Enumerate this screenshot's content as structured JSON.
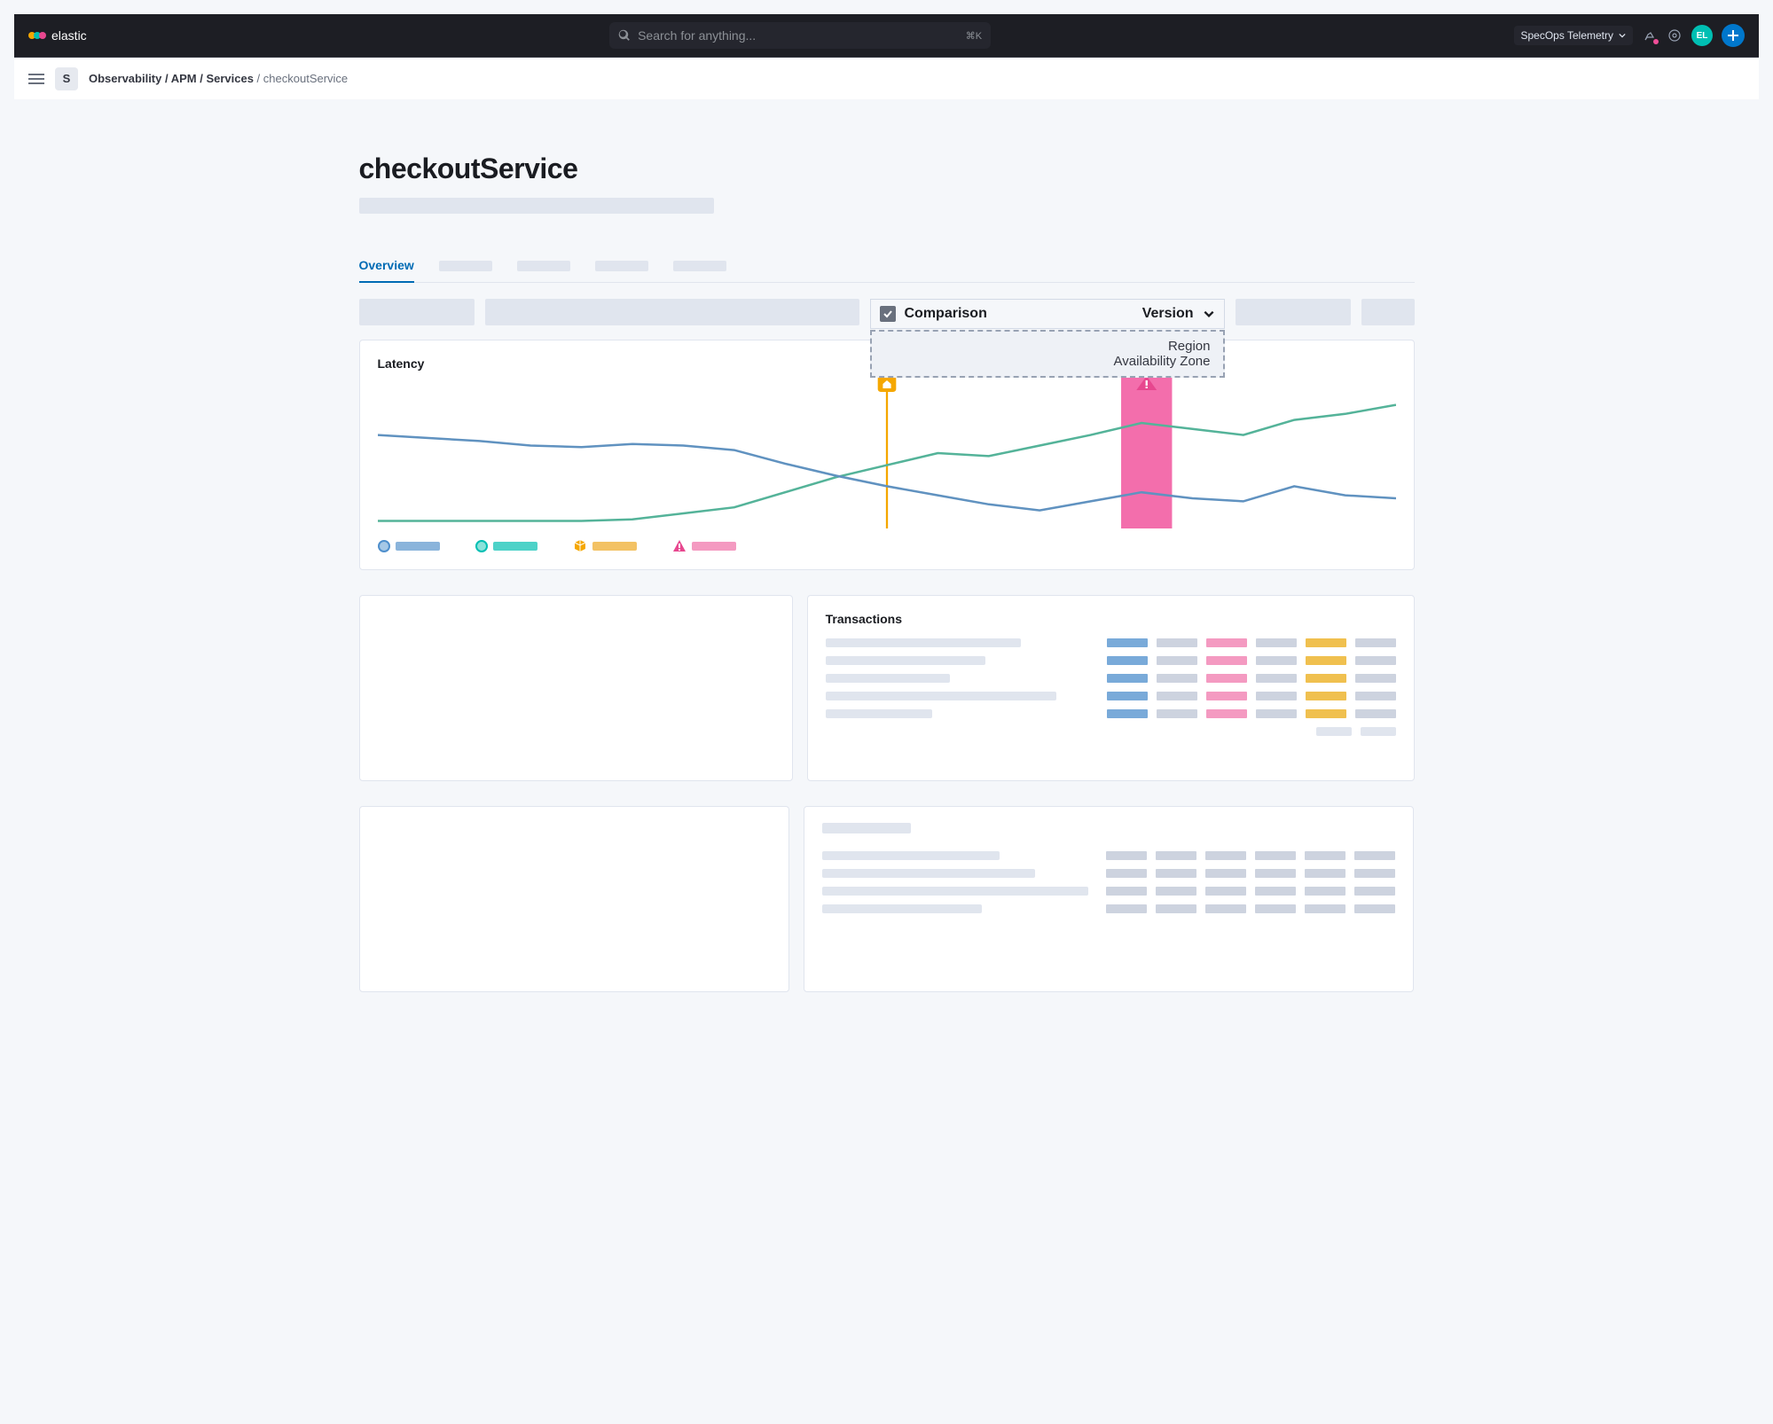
{
  "header": {
    "brand": "elastic",
    "search_placeholder": "Search for anything...",
    "search_shortcut": "⌘K",
    "space_label": "SpecOps Telemetry",
    "avatar_initials": "EL"
  },
  "subheader": {
    "space_badge": "S",
    "breadcrumb_main": "Observability / APM / Services",
    "breadcrumb_sep": " / ",
    "breadcrumb_current": "checkoutService"
  },
  "page": {
    "title": "checkoutService"
  },
  "tabs": {
    "active": "Overview"
  },
  "comparison": {
    "label": "Comparison",
    "selected": "Version",
    "options": [
      "Region",
      "Availability Zone"
    ]
  },
  "latency_panel": {
    "title": "Latency"
  },
  "transactions_panel": {
    "title": "Transactions"
  },
  "colors": {
    "blue": "#6092c0",
    "teal": "#00bfb3",
    "yellow": "#f5a700",
    "pink": "#e7478f",
    "green_line": "#54b399",
    "blue_line": "#6092c0"
  },
  "chart_data": {
    "type": "line",
    "title": "Latency",
    "xlabel": "",
    "ylabel": "",
    "ylim": [
      0,
      100
    ],
    "x": [
      0,
      5,
      10,
      15,
      20,
      25,
      30,
      35,
      40,
      45,
      50,
      55,
      60,
      65,
      70,
      75,
      80,
      85,
      90,
      95,
      100
    ],
    "series": [
      {
        "name": "blue",
        "color": "#6092c0",
        "values": [
          62,
          60,
          58,
          55,
          54,
          56,
          55,
          52,
          43,
          35,
          28,
          22,
          16,
          12,
          18,
          24,
          20,
          18,
          28,
          22,
          20
        ]
      },
      {
        "name": "green",
        "color": "#54b399",
        "values": [
          5,
          5,
          5,
          5,
          5,
          6,
          10,
          14,
          24,
          34,
          42,
          50,
          48,
          55,
          62,
          70,
          66,
          62,
          72,
          76,
          82
        ]
      }
    ],
    "markers": [
      {
        "type": "deploy",
        "x": 50,
        "color": "#f5a700"
      },
      {
        "type": "alert",
        "x_start": 73,
        "x_end": 78,
        "color": "#f36eac"
      }
    ],
    "legend": [
      {
        "kind": "circle",
        "color": "#4f8fcc",
        "fill": "#a6c8e6"
      },
      {
        "kind": "circle",
        "color": "#00bfb3",
        "fill": "#8be2da"
      },
      {
        "kind": "cube",
        "color": "#f5a700"
      },
      {
        "kind": "alert",
        "color": "#e7478f"
      }
    ]
  }
}
